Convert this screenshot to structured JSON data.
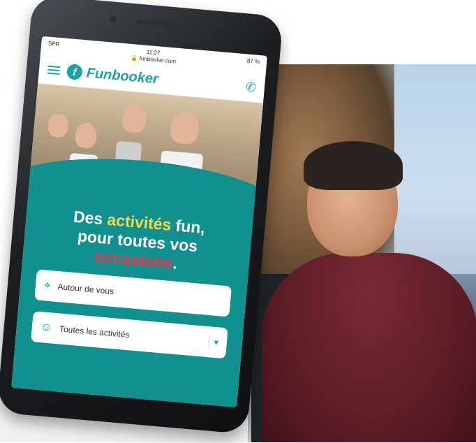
{
  "status_bar": {
    "carrier": "SFR",
    "time": "11:27",
    "battery": "87 %"
  },
  "browser": {
    "url": "funbooker.com"
  },
  "site": {
    "brand_mark": "f",
    "brand_name": "Funbooker"
  },
  "hero": {
    "headline_part1": "Des ",
    "headline_highlight1": "activités",
    "headline_part2": " fun,",
    "headline_line2": "pour toutes vos",
    "headline_highlight2": "occasions",
    "headline_end": "."
  },
  "search": {
    "location_placeholder": "Autour de vous",
    "activity_value": "Toutes les activités"
  },
  "colors": {
    "brand_teal": "#11908f",
    "highlight_yellow": "#f6d94a",
    "highlight_red": "#e6394b"
  },
  "icons": {
    "menu": "menu-icon",
    "phone": "phone-icon",
    "location": "location-pin-icon",
    "smiley": "smiley-icon",
    "dropdown": "chevron-down-icon"
  }
}
